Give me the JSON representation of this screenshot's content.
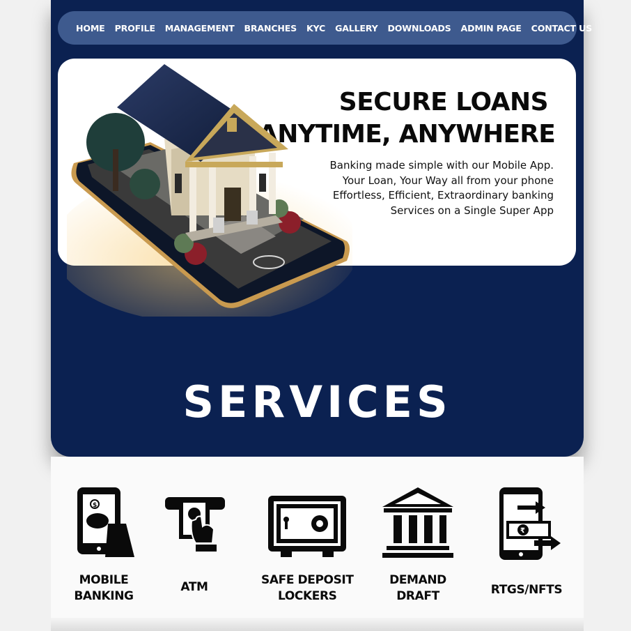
{
  "nav": {
    "items": [
      {
        "label": "HOME"
      },
      {
        "label": "PROFILE"
      },
      {
        "label": "MANAGEMENT"
      },
      {
        "label": "BRANCHES"
      },
      {
        "label": "KYC"
      },
      {
        "label": "GALLERY"
      },
      {
        "label": "DOWNLOADS"
      },
      {
        "label": "ADMIN PAGE"
      },
      {
        "label": "CONTACT US"
      }
    ]
  },
  "banner": {
    "headline_line1": "SECURE LOANS",
    "headline_line2": "ANYTIME, ANYWHERE",
    "tagline": [
      "Banking made simple with our Mobile App.",
      "Your Loan, Your Way all from your phone",
      "Effortless, Efficient, Extraordinary banking",
      "Services on a Single Super App"
    ]
  },
  "services": {
    "title": "SERVICES",
    "items": [
      {
        "label": "MOBILE\nBANKING",
        "icon": "mobile-banking-icon"
      },
      {
        "label": "ATM",
        "icon": "atm-icon"
      },
      {
        "label": "SAFE DEPOSIT\nLOCKERS",
        "icon": "safe-locker-icon"
      },
      {
        "label": "DEMAND\nDRAFT",
        "icon": "bank-building-icon"
      },
      {
        "label": "RTGS/NFTS",
        "icon": "money-transfer-icon"
      }
    ]
  },
  "colors": {
    "hero_bg": "#0b2151",
    "nav_bg": "#3e5a8e",
    "banner_bg": "#ffffff",
    "text_dark": "#0a0a0a"
  }
}
